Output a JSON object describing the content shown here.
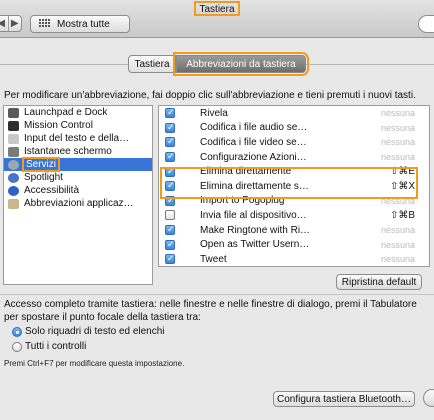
{
  "window": {
    "title": "Tastiera",
    "nav_back_icon": "◀",
    "nav_forward_icon": "▶",
    "show_all_label": "Mostra tutte"
  },
  "tabs": [
    {
      "label": "Tastiera",
      "active": false
    },
    {
      "label": "Abbreviazioni da tastiera",
      "active": true
    }
  ],
  "instructions": "Per modificare un'abbreviazione, fai doppio clic sull'abbreviazione e tieni premuti i nuovi tasti.",
  "categories": [
    {
      "label": "Launchpad e Dock",
      "icon": "launchpad-icon",
      "color": "#5a5a5a",
      "selected": false
    },
    {
      "label": "Mission Control",
      "icon": "mission-control-icon",
      "color": "#2d2d2d",
      "selected": false
    },
    {
      "label": "Input del testo e della…",
      "icon": "text-input-icon",
      "color": "#c8c8c8",
      "selected": false
    },
    {
      "label": "Istantanee schermo",
      "icon": "screenshot-icon",
      "color": "#7b7b7b",
      "selected": false
    },
    {
      "label": "Servizi",
      "icon": "services-gear-icon",
      "color": "#9aa7b5",
      "selected": true
    },
    {
      "label": "Spotlight",
      "icon": "spotlight-icon",
      "color": "#4a74c9",
      "selected": false
    },
    {
      "label": "Accessibilità",
      "icon": "accessibility-icon",
      "color": "#2f62c9",
      "selected": false
    },
    {
      "label": "Abbreviazioni applicaz…",
      "icon": "app-shortcuts-icon",
      "color": "#c9b78a",
      "selected": false
    }
  ],
  "services": [
    {
      "checked": true,
      "label": "Rivela",
      "key": "nessuna",
      "strong": false
    },
    {
      "checked": true,
      "label": "Codifica i file audio se…",
      "key": "nessuna",
      "strong": false
    },
    {
      "checked": true,
      "label": "Codifica i file video se…",
      "key": "nessuna",
      "strong": false
    },
    {
      "checked": true,
      "label": "Configurazione Azioni…",
      "key": "nessuna",
      "strong": false
    },
    {
      "checked": true,
      "label": "Elimina direttamente",
      "key": "⇧⌘E",
      "strong": true
    },
    {
      "checked": true,
      "label": "Elimina direttamente s…",
      "key": "⇧⌘X",
      "strong": true
    },
    {
      "checked": true,
      "label": "Import to Pogoplug",
      "key": "nessuna",
      "strong": false
    },
    {
      "checked": false,
      "label": "Invia file al dispositivo…",
      "key": "⇧⌘B",
      "strong": true
    },
    {
      "checked": true,
      "label": "Make Ringtone with Ri…",
      "key": "nessuna",
      "strong": false
    },
    {
      "checked": true,
      "label": "Open as Twitter Usern…",
      "key": "nessuna",
      "strong": false
    },
    {
      "checked": true,
      "label": "Tweet",
      "key": "nessuna",
      "strong": false
    }
  ],
  "restore_defaults_label": "Ripristina default",
  "full_keyboard_access": {
    "line1": "Accesso completo tramite tastiera: nelle finestre e nelle finestre di dialogo, premi il Tabulatore",
    "line2": "per spostare il punto focale della tastiera tra:",
    "options": [
      {
        "label": "Solo riquadri di testo ed elenchi",
        "selected": true
      },
      {
        "label": "Tutti i controlli",
        "selected": false
      }
    ],
    "hint": "Premi Ctrl+F7 per modificare questa impostazione."
  },
  "bluetooth_button_label": "Configura tastiera Bluetooth…",
  "colors": {
    "highlight_box": "#f29b1e",
    "selection": "#3875d7"
  }
}
